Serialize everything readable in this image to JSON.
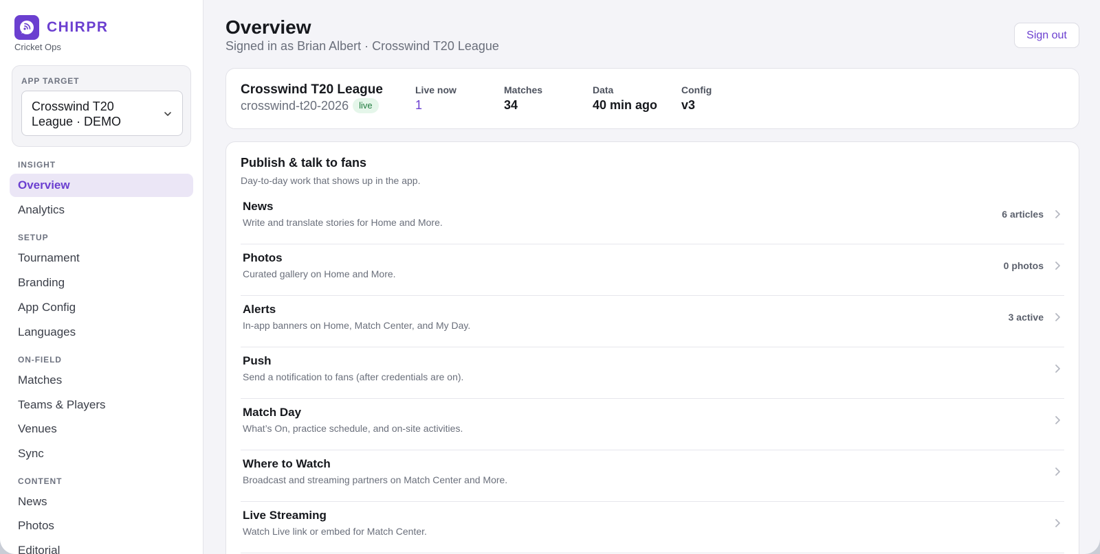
{
  "brand": {
    "name": "CHIRPR",
    "subtitle": "Cricket Ops",
    "logo_icon": "chat-bubble-wifi-icon",
    "accent": "#6b3fd0"
  },
  "app_target": {
    "label": "APP TARGET",
    "selected_line1": "Crosswind T20",
    "selected_line2": "League · DEMO"
  },
  "nav": {
    "insight": {
      "label": "INSIGHT",
      "items": [
        "Overview",
        "Analytics"
      ]
    },
    "setup": {
      "label": "SETUP",
      "items": [
        "Tournament",
        "Branding",
        "App Config",
        "Languages"
      ]
    },
    "onfield": {
      "label": "ON-FIELD",
      "items": [
        "Matches",
        "Teams & Players",
        "Venues",
        "Sync"
      ]
    },
    "content": {
      "label": "CONTENT",
      "items": [
        "News",
        "Photos",
        "Editorial"
      ]
    },
    "active": "Overview"
  },
  "header": {
    "title": "Overview",
    "subtitle": "Signed in as Brian Albert · Crosswind T20 League",
    "signout": "Sign out"
  },
  "summary": {
    "league_name": "Crosswind T20 League",
    "slug": "crosswind-t20-2026",
    "status": "live",
    "stats": [
      {
        "label": "Live now",
        "value": "1"
      },
      {
        "label": "Matches",
        "value": "34"
      },
      {
        "label": "Data",
        "value": "40 min ago"
      },
      {
        "label": "Config",
        "value": "v3"
      }
    ]
  },
  "panel": {
    "title": "Publish & talk to fans",
    "subtitle": "Day-to-day work that shows up in the app.",
    "rows": [
      {
        "title": "News",
        "desc": "Write and translate stories for Home and More.",
        "count": "6 articles"
      },
      {
        "title": "Photos",
        "desc": "Curated gallery on Home and More.",
        "count": "0 photos"
      },
      {
        "title": "Alerts",
        "desc": "In-app banners on Home, Match Center, and My Day.",
        "count": "3 active"
      },
      {
        "title": "Push",
        "desc": "Send a notification to fans (after credentials are on).",
        "count": ""
      },
      {
        "title": "Match Day",
        "desc": "What’s On, practice schedule, and on-site activities.",
        "count": ""
      },
      {
        "title": "Where to Watch",
        "desc": "Broadcast and streaming partners on Match Center and More.",
        "count": ""
      },
      {
        "title": "Live Streaming",
        "desc": "Watch Live link or embed for Match Center.",
        "count": ""
      }
    ]
  }
}
